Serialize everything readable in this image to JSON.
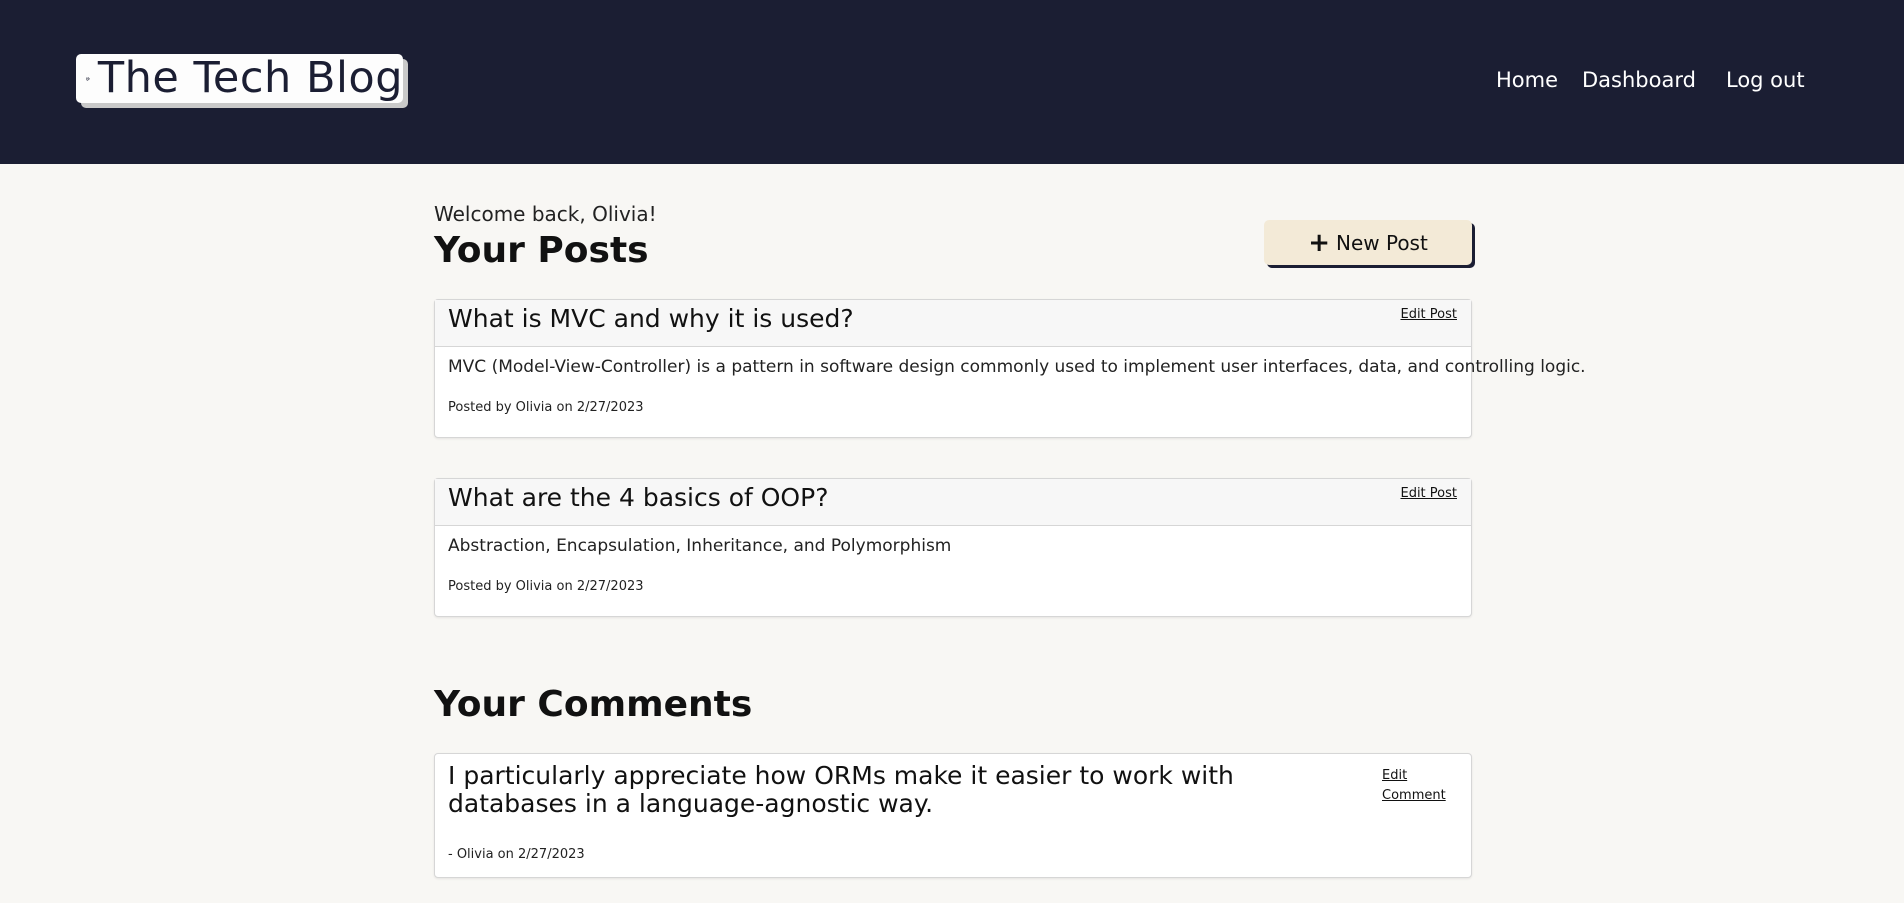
{
  "header": {
    "logo_text": "The Tech Blog",
    "logo_icon": "blog-icon",
    "nav": [
      {
        "label": "Home"
      },
      {
        "label": "Dashboard"
      },
      {
        "label": "Log out"
      }
    ]
  },
  "dashboard": {
    "welcome": "Welcome back, Olivia!",
    "posts_title": "Your Posts",
    "new_post_label": "New Post",
    "posts": [
      {
        "title": "What is MVC and why it is used?",
        "edit_label": "Edit Post",
        "content": "MVC (Model-View-Controller) is a pattern in software design commonly used to implement user interfaces, data, and controlling logic.",
        "meta": "Posted by Olivia on 2/27/2023"
      },
      {
        "title": "What are the 4 basics of OOP?",
        "edit_label": "Edit Post",
        "content": "Abstraction, Encapsulation, Inheritance, and Polymorphism",
        "meta": "Posted by Olivia on 2/27/2023"
      }
    ],
    "comments_title": "Your Comments",
    "comments": [
      {
        "text": "I particularly appreciate how ORMs make it easier to work with databases in a language-agnostic way.",
        "edit_label": "Edit Comment",
        "meta": "- Olivia on 2/27/2023"
      }
    ]
  },
  "colors": {
    "header_bg": "#1b1e33",
    "page_bg": "#f8f7f4",
    "button_bg": "#f3ead7"
  }
}
